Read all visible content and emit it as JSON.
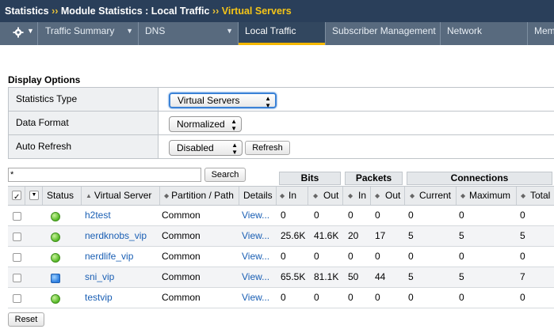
{
  "breadcrumb": {
    "part1": "Statistics",
    "sep1": "››",
    "part2": "Module Statistics : Local Traffic",
    "sep2": "››",
    "current": "Virtual Servers"
  },
  "tabs": [
    {
      "label": "Traffic Summary",
      "has_menu": true
    },
    {
      "label": "DNS",
      "has_menu": true
    },
    {
      "label": "Local Traffic",
      "has_menu": false,
      "active": true
    },
    {
      "label": "Subscriber Management",
      "has_menu": false
    },
    {
      "label": "Network",
      "has_menu": false
    },
    {
      "label": "Mem",
      "has_menu": false
    }
  ],
  "display_options": {
    "title": "Display Options",
    "rows": [
      {
        "label": "Statistics Type",
        "value": "Virtual Servers"
      },
      {
        "label": "Data Format",
        "value": "Normalized"
      },
      {
        "label": "Auto Refresh",
        "value": "Disabled",
        "button": "Refresh"
      }
    ]
  },
  "search": {
    "value": "*",
    "button": "Search"
  },
  "group_headers": {
    "bits": "Bits",
    "packets": "Packets",
    "connections": "Connections"
  },
  "columns": {
    "status": "Status",
    "virtual_server": "Virtual Server",
    "partition": "Partition / Path",
    "details": "Details",
    "bits_in": "In",
    "bits_out": "Out",
    "pkts_in": "In",
    "pkts_out": "Out",
    "current": "Current",
    "maximum": "Maximum",
    "total": "Total"
  },
  "rows": [
    {
      "name": "h2test",
      "status": "green",
      "partition": "Common",
      "details": "View...",
      "bits_in": "0",
      "bits_out": "0",
      "pkts_in": "0",
      "pkts_out": "0",
      "current": "0",
      "maximum": "0",
      "total": "0"
    },
    {
      "name": "nerdknobs_vip",
      "status": "green",
      "partition": "Common",
      "details": "View...",
      "bits_in": "25.6K",
      "bits_out": "41.6K",
      "pkts_in": "20",
      "pkts_out": "17",
      "current": "5",
      "maximum": "5",
      "total": "5"
    },
    {
      "name": "nerdlife_vip",
      "status": "green",
      "partition": "Common",
      "details": "View...",
      "bits_in": "0",
      "bits_out": "0",
      "pkts_in": "0",
      "pkts_out": "0",
      "current": "0",
      "maximum": "0",
      "total": "0"
    },
    {
      "name": "sni_vip",
      "status": "blue",
      "partition": "Common",
      "details": "View...",
      "bits_in": "65.5K",
      "bits_out": "81.1K",
      "pkts_in": "50",
      "pkts_out": "44",
      "current": "5",
      "maximum": "5",
      "total": "7"
    },
    {
      "name": "testvip",
      "status": "green",
      "partition": "Common",
      "details": "View...",
      "bits_in": "0",
      "bits_out": "0",
      "pkts_in": "0",
      "pkts_out": "0",
      "current": "0",
      "maximum": "0",
      "total": "0"
    }
  ],
  "reset_button": "Reset",
  "colors": {
    "header_bg": "#2a3f5a",
    "tab_bg": "#586a7e",
    "active_tab_underline": "#f5b800",
    "link": "#1a5fb4",
    "current_crumb": "#f5c518"
  }
}
